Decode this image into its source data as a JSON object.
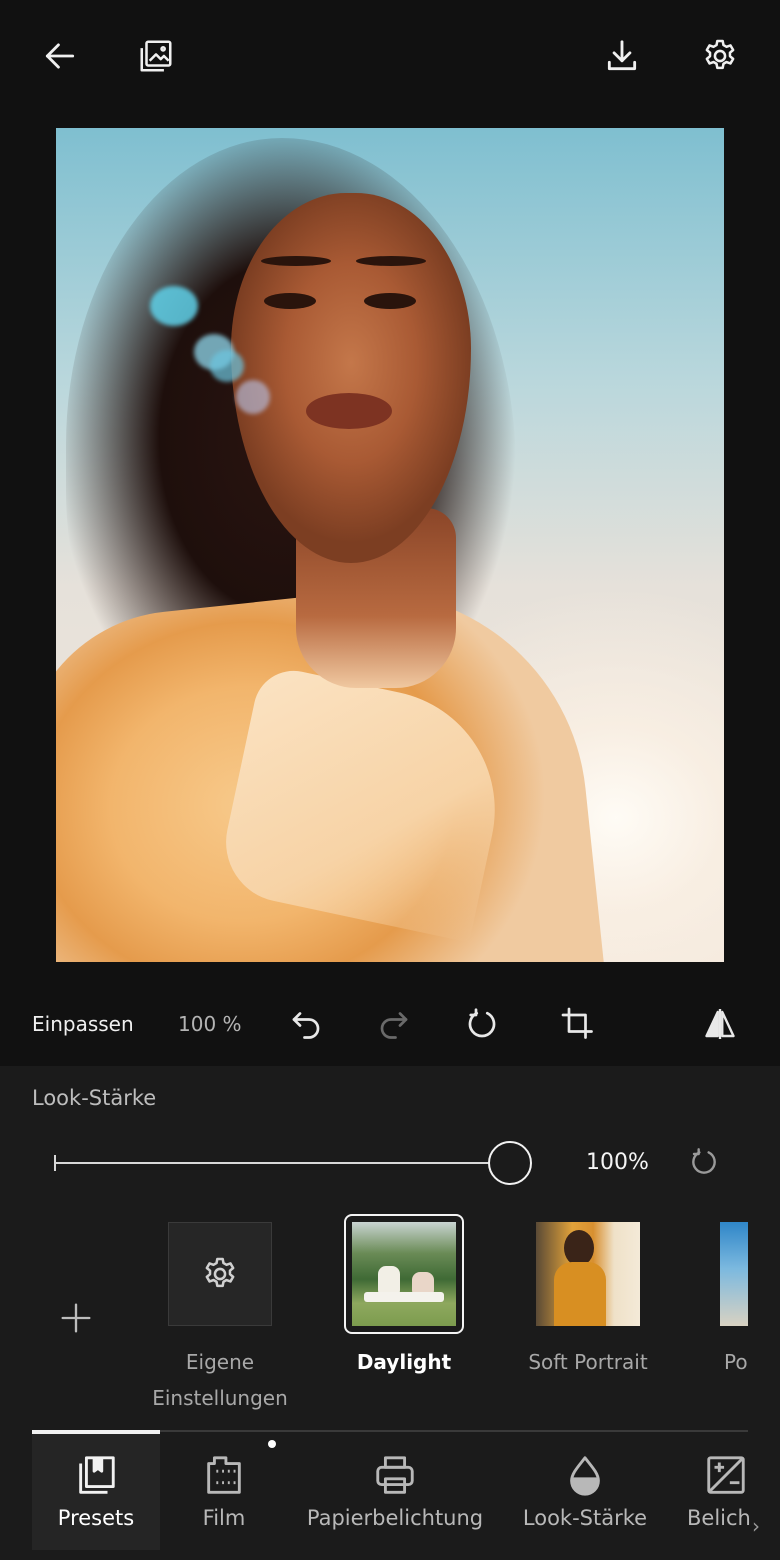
{
  "toolbar": {
    "fit_label": "Einpassen",
    "zoom_label": "100 %"
  },
  "look_strength": {
    "title": "Look-Stärke",
    "value": 100,
    "value_label": "100%"
  },
  "presets": [
    {
      "label": "Eigene Einstellungen",
      "label_line1": "Eigene",
      "label_line2": "Einstellungen",
      "selected": false
    },
    {
      "label": "Daylight",
      "selected": true
    },
    {
      "label": "Soft Portrait",
      "selected": false
    },
    {
      "label": "Po",
      "selected": false
    }
  ],
  "tabs": [
    {
      "label": "Presets",
      "icon": "presets-icon",
      "active": true
    },
    {
      "label": "Film",
      "icon": "film-icon",
      "active": false,
      "has_dot": true
    },
    {
      "label": "Papierbelichtung",
      "icon": "printer-icon",
      "active": false
    },
    {
      "label": "Look-Stärke",
      "icon": "drop-icon",
      "active": false
    },
    {
      "label": "Belich",
      "icon": "exposure-icon",
      "active": false
    }
  ],
  "colors": {
    "background": "#111111",
    "panel": "#1b1b1b",
    "text_primary": "#ffffff",
    "text_secondary": "#a8a8a8"
  }
}
